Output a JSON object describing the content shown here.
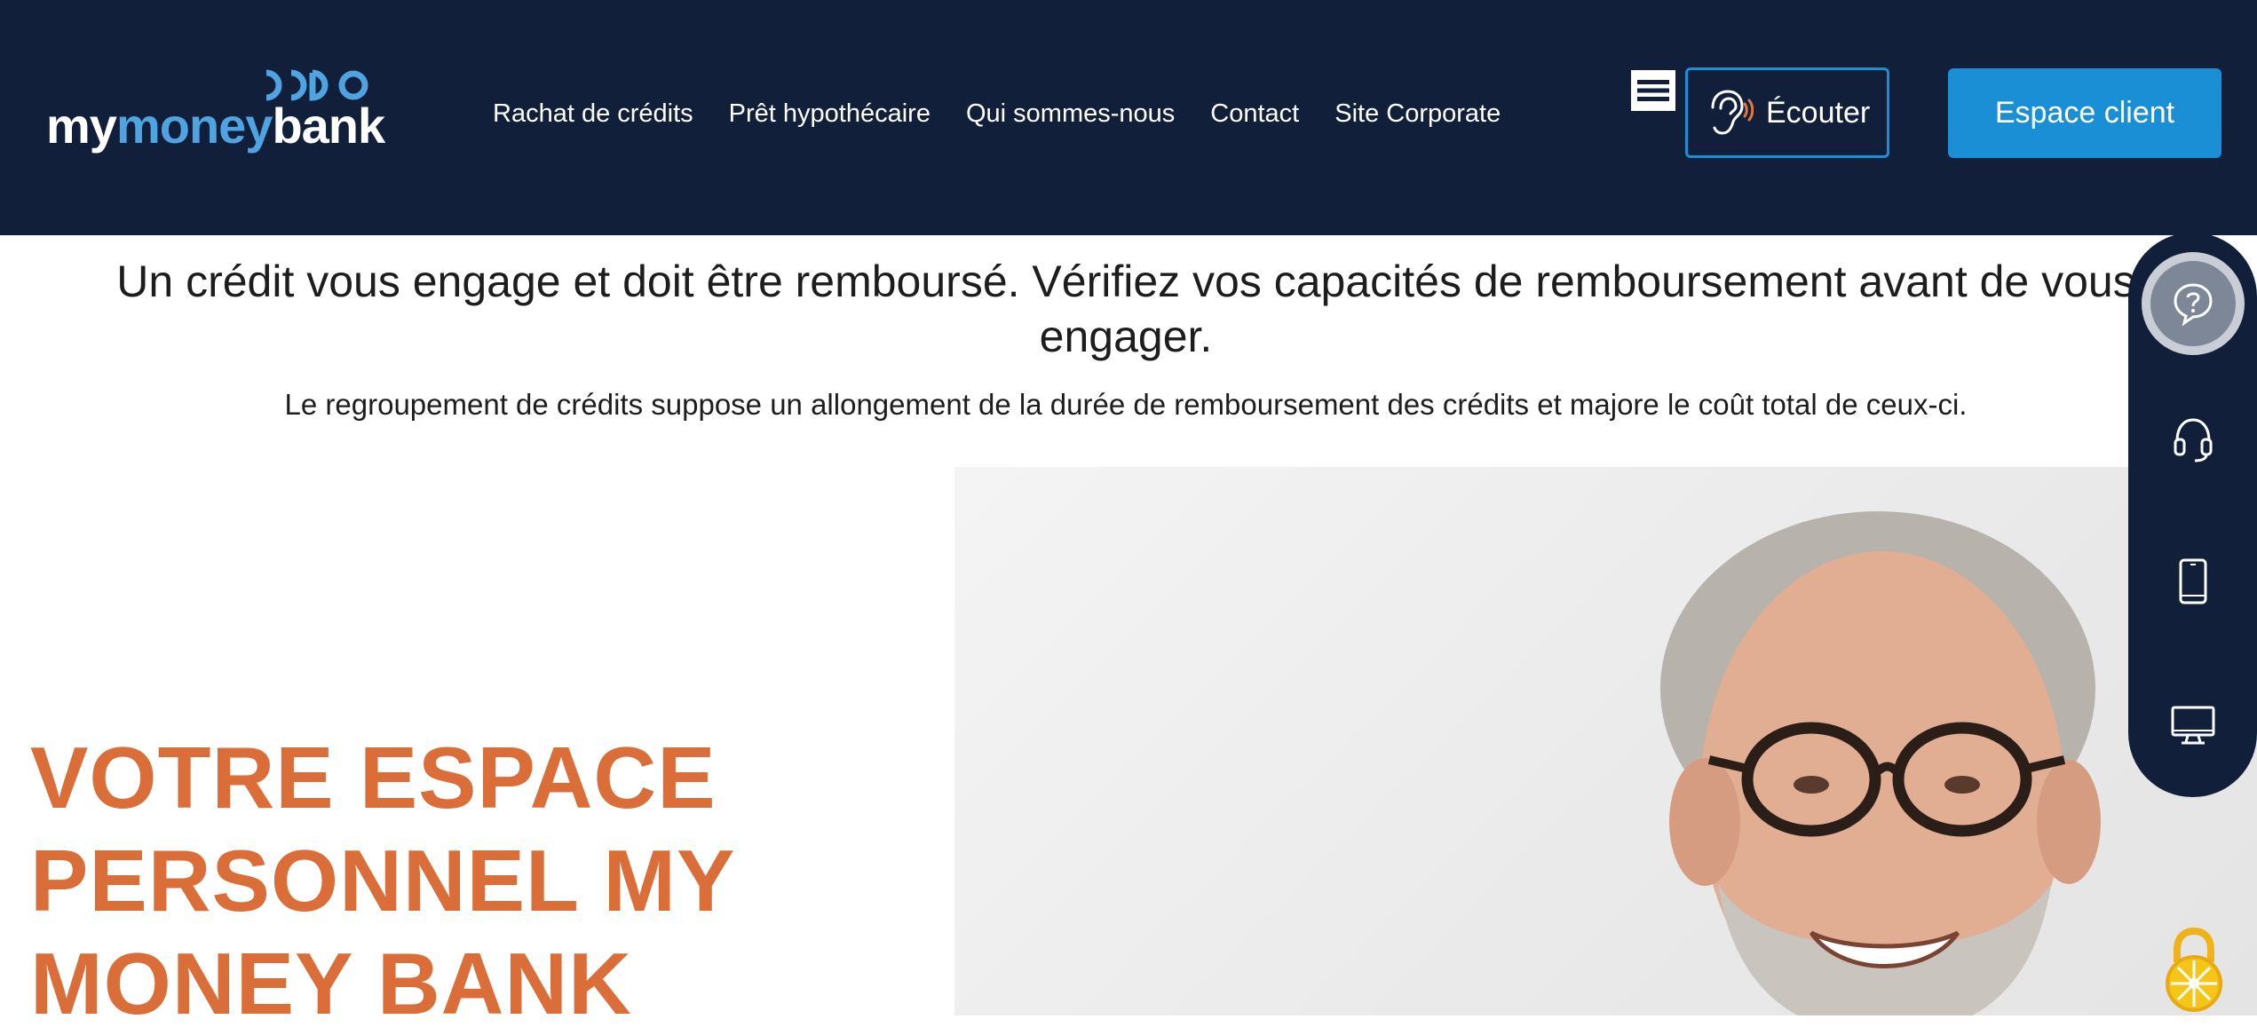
{
  "header": {
    "logo": {
      "text_part1": "my",
      "text_part2": "money",
      "text_part3": "bank"
    },
    "nav": [
      {
        "label": "Rachat de crédits"
      },
      {
        "label": "Prêt hypothécaire"
      },
      {
        "label": "Qui sommes-nous"
      },
      {
        "label": "Contact"
      },
      {
        "label": "Site Corporate"
      }
    ],
    "menu_icon": "hamburger-icon",
    "listen_label": "Écouter",
    "client_label": "Espace client"
  },
  "notice": {
    "main": "Un crédit vous engage et doit être remboursé. Vérifiez vos capacités de remboursement avant de vous engager.",
    "sub": "Le regroupement de crédits suppose un allongement de la durée de remboursement des crédits et majore le coût total de ceux-ci."
  },
  "hero": {
    "headline": "VOTRE ESPACE PERSONNEL MY MONEY BANK"
  },
  "dock": {
    "items": [
      "help-icon",
      "headset-icon",
      "mobile-icon",
      "desktop-icon"
    ]
  },
  "colors": {
    "header_bg": "#121f3b",
    "accent_blue": "#1a8fd6",
    "headline_orange": "#db6d39"
  }
}
